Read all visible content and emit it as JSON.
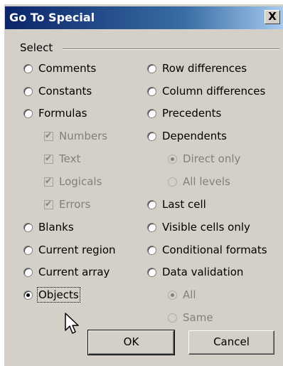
{
  "dialog": {
    "title": "Go To Special",
    "close_symbol": "X"
  },
  "group": {
    "label": "Select"
  },
  "left_options": {
    "comments": "Comments",
    "constants": "Constants",
    "formulas": "Formulas",
    "numbers": "Numbers",
    "text": "Text",
    "logicals": "Logicals",
    "errors": "Errors",
    "blanks": "Blanks",
    "current_region": "Current region",
    "current_array": "Current array",
    "objects": "Objects"
  },
  "right_options": {
    "row_differences": "Row differences",
    "column_differences": "Column differences",
    "precedents": "Precedents",
    "dependents": "Dependents",
    "direct_only": "Direct only",
    "all_levels": "All levels",
    "last_cell": "Last cell",
    "visible_cells_only": "Visible cells only",
    "conditional_formats": "Conditional formats",
    "data_validation": "Data validation",
    "all": "All",
    "same": "Same"
  },
  "selected_option": "Objects",
  "buttons": {
    "ok": "OK",
    "cancel": "Cancel"
  },
  "icons": {
    "close": "close-icon",
    "cursor": "mouse-pointer-icon"
  },
  "colors": {
    "title_bar_start": "#0a246a",
    "title_bar_end": "#a6caf0",
    "dialog_bg": "#d4d0c8"
  }
}
